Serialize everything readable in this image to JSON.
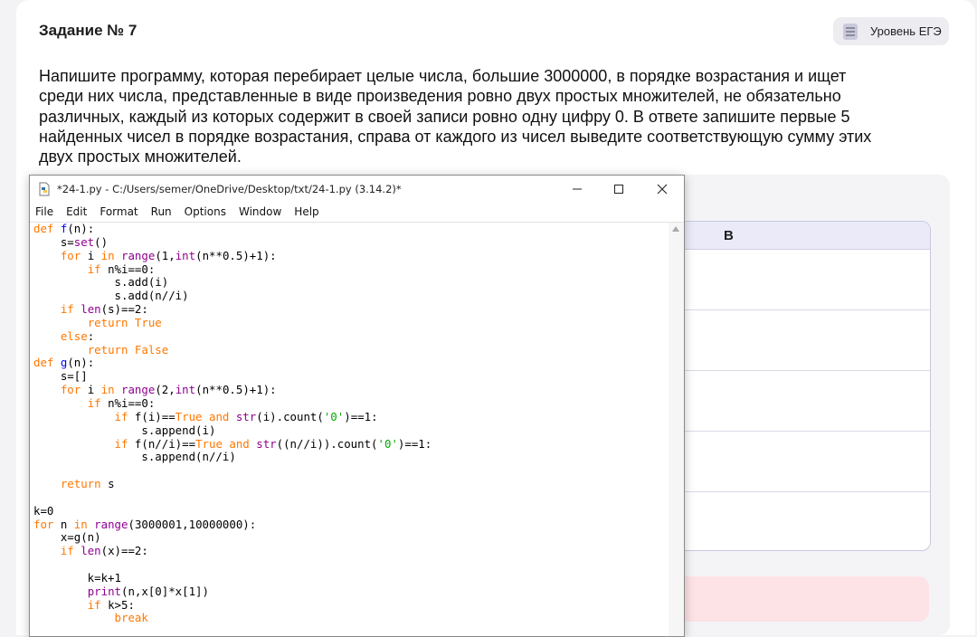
{
  "task": {
    "title": "Задание № 7",
    "level_label": "Уровень ЕГЭ",
    "text": "Напишите программу, которая перебирает целые числа, большие 3000000, в порядке возрастания и ищет среди них числа, представленные в виде произведения ровно двух простых множителей, не обязательно различных, каждый из которых содержит в своей записи ровно одну цифру 0. В ответе запишите первые 5 найденных чисел в порядке возрастания, справа от каждого из чисел выведите соответствующую сумму этих двух простых множителей."
  },
  "answer_table": {
    "column_b": "B"
  },
  "idle": {
    "title": "*24-1.py - C:/Users/semer/OneDrive/Desktop/txt/24-1.py (3.14.2)*",
    "menu": [
      "File",
      "Edit",
      "Format",
      "Run",
      "Options",
      "Window",
      "Help"
    ],
    "code": [
      "def f(n):",
      "    s=set()",
      "    for i in range(1,int(n**0.5)+1):",
      "        if n%i==0:",
      "            s.add(i)",
      "            s.add(n//i)",
      "    if len(s)==2:",
      "        return True",
      "    else:",
      "        return False",
      "def g(n):",
      "    s=[]",
      "    for i in range(2,int(n**0.5)+1):",
      "        if n%i==0:",
      "            if f(i)==True and str(i).count('0')==1:",
      "                s.append(i)",
      "            if f(n//i)==True and str((n//i)).count('0')==1:",
      "                s.append(n//i)",
      "",
      "    return s",
      "",
      "k=0",
      "for n in range(3000001,10000000):",
      "    x=g(n)",
      "    if len(x)==2:",
      "",
      "        k=k+1",
      "        print(n,x[0]*x[1])",
      "        if k>5:",
      "            break"
    ]
  },
  "colors": {
    "keyword": "#ff7700",
    "builtin": "#900090",
    "defname": "#0000ff",
    "string": "#00aa00"
  }
}
